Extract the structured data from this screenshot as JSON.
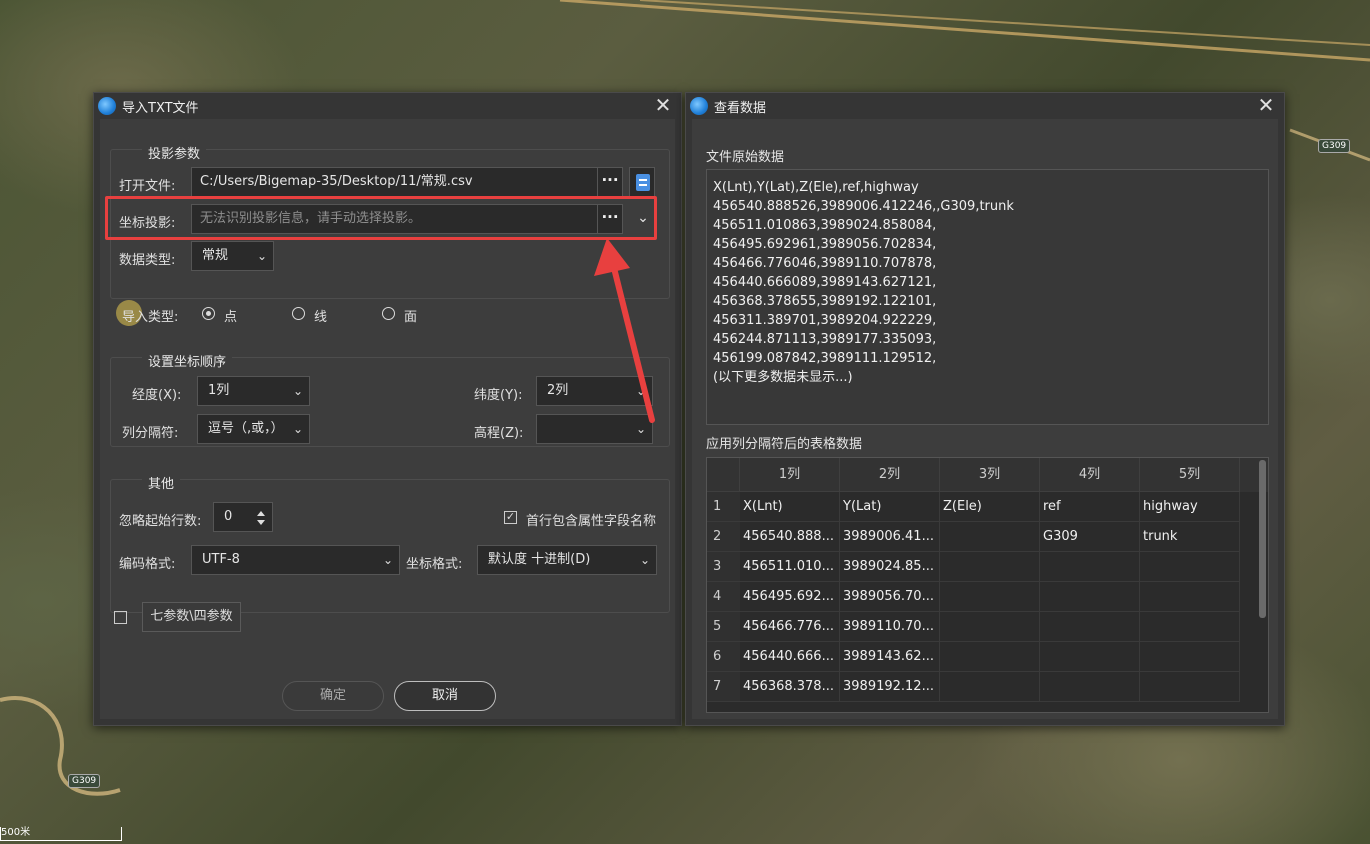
{
  "map": {
    "road_labels": [
      "G309",
      "G309"
    ],
    "scale_text": "500米"
  },
  "import_dialog": {
    "title": "导入TXT文件",
    "close": "✕",
    "projection_group": "投影参数",
    "open_file_label": "打开文件:",
    "open_file_value": "C:/Users/Bigemap-35/Desktop/11/常规.csv",
    "browse_label": "···",
    "coord_proj_label": "坐标投影:",
    "coord_proj_placeholder": "无法识别投影信息，请手动选择投影。",
    "coord_proj_browse": "···",
    "data_type_label": "数据类型:",
    "data_type_value": "常规",
    "import_type_label": "导入类型:",
    "import_types": [
      "点",
      "线",
      "面"
    ],
    "import_type_selected": "点",
    "coord_order_group": "设置坐标顺序",
    "lng_label": "经度(X):",
    "lng_value": "1列",
    "lat_label": "纬度(Y):",
    "lat_value": "2列",
    "separator_label": "列分隔符:",
    "separator_value": "逗号（,或，）",
    "elev_label": "高程(Z):",
    "elev_value": "",
    "other_group": "其他",
    "skip_rows_label": "忽略起始行数:",
    "skip_rows_value": "0",
    "header_checkbox_label": "首行包含属性字段名称",
    "header_checkbox_checked": true,
    "encoding_label": "编码格式:",
    "encoding_value": "UTF-8",
    "coord_format_label": "坐标格式:",
    "coord_format_value": "默认度 十进制(D)",
    "seven_param_checked": false,
    "seven_param_button": "七参数\\四参数",
    "ok_button": "确定",
    "cancel_button": "取消"
  },
  "view_dialog": {
    "title": "查看数据",
    "close": "✕",
    "raw_section_title": "文件原始数据",
    "raw_lines": [
      "X(Lnt),Y(Lat),Z(Ele),ref,highway",
      "456540.888526,3989006.412246,,G309,trunk",
      "456511.010863,3989024.858084,",
      "456495.692961,3989056.702834,",
      "456466.776046,3989110.707878,",
      "456440.666089,3989143.627121,",
      "456368.378655,3989192.122101,",
      "456311.389701,3989204.922229,",
      "456244.871113,3989177.335093,",
      "456199.087842,3989111.129512,",
      "(以下更多数据未显示...)"
    ],
    "table_section_title": "应用列分隔符后的表格数据",
    "table_columns": [
      "1列",
      "2列",
      "3列",
      "4列",
      "5列"
    ],
    "table_rows": [
      {
        "num": "1",
        "cells": [
          "X(Lnt)",
          "Y(Lat)",
          "Z(Ele)",
          "ref",
          "highway"
        ]
      },
      {
        "num": "2",
        "cells": [
          "456540.888...",
          "3989006.41...",
          "",
          "G309",
          "trunk"
        ]
      },
      {
        "num": "3",
        "cells": [
          "456511.010...",
          "3989024.85...",
          "",
          "",
          ""
        ]
      },
      {
        "num": "4",
        "cells": [
          "456495.692...",
          "3989056.70...",
          "",
          "",
          ""
        ]
      },
      {
        "num": "5",
        "cells": [
          "456466.776...",
          "3989110.70...",
          "",
          "",
          ""
        ]
      },
      {
        "num": "6",
        "cells": [
          "456440.666...",
          "3989143.62...",
          "",
          "",
          ""
        ]
      },
      {
        "num": "7",
        "cells": [
          "456368.378...",
          "3989192.12...",
          "",
          "",
          ""
        ]
      }
    ]
  },
  "colors": {
    "highlight": "#e8403f",
    "accent": "#1f7fd8"
  }
}
